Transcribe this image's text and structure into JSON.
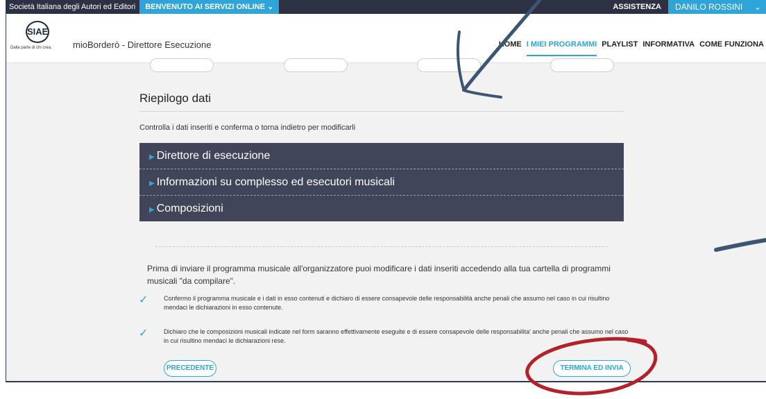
{
  "topbar": {
    "org_name": "Società Italiana degli Autori ed Editori",
    "welcome": "BENVENUTO AI SERVIZI ONLINE",
    "welcome_chevron": "⌄",
    "assistance": "ASSISTENZA",
    "user_name": "DANILO ROSSINI",
    "user_chevron": "⌄"
  },
  "header": {
    "logo_text": "SIAE",
    "logo_tagline": "Dalla parte di chi crea.",
    "app_title": "mioBorderò - Direttore Esecuzione",
    "nav": [
      "HOME",
      "I MIEI PROGRAMMI",
      "PLAYLIST",
      "INFORMATIVA",
      "COME FUNZIONA"
    ],
    "active_nav": "I MIEI PROGRAMMI"
  },
  "main": {
    "section_title": "Riepilogo dati",
    "subtitle": "Controlla i dati inseriti e conferma o torna indietro per modificarli",
    "accordion": [
      "Direttore di esecuzione",
      "Informazioni su complesso ed esecutori musicali",
      "Composizioni"
    ],
    "intro": "Prima di inviare il programma musicale all'organizzatore puoi modificare i dati inseriti accedendo alla tua cartella di programmi musicali \"da compilare\".",
    "checks": [
      "Confermo il programma musicale e i dati in esso contenuti e dichiaro di essere consapevole delle responsabilità anche penali che assumo nel caso in cui risultino mendaci le dichiarazioni in esso contenute.",
      "Dichiaro che le composizioni musicali indicate nel form saranno effettivamente eseguite e di essere consapevole delle responsabilita' anche penali che assumo nel caso in cui risultino mendaci le dichiarazioni rese."
    ],
    "check_icon": "✓",
    "prev_button": "PRECEDENTE",
    "submit_button": "TERMINA ED INVIA"
  },
  "colors": {
    "accent": "#2fa4d9",
    "dark_bar": "#2d3144",
    "accordion_bg": "#404559",
    "annotation_red": "#b3222a",
    "annotation_arrow": "#3c5570"
  }
}
